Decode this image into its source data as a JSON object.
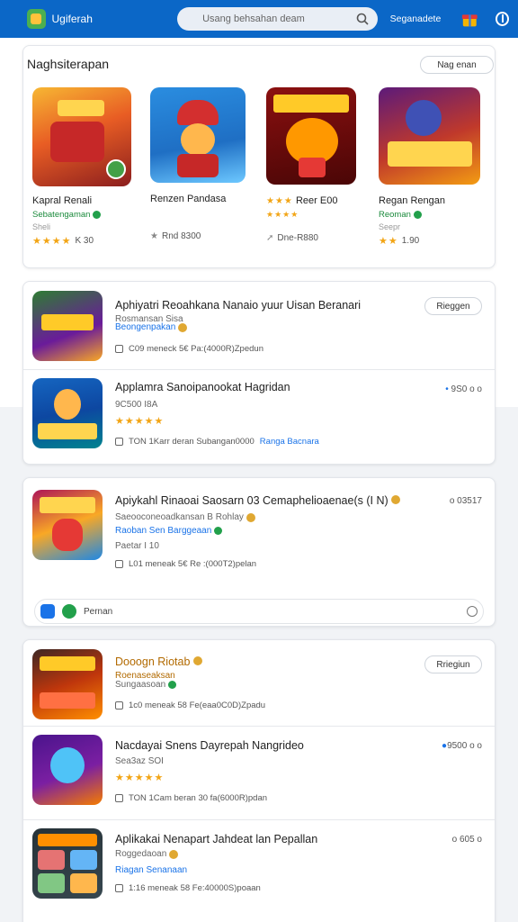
{
  "header": {
    "app_name": "Ugiferah",
    "search_placeholder": "Usang behsahan deam",
    "sign_in": "Seganadete"
  },
  "featured": {
    "title": "Naghsiterapan",
    "see_more": "Nag enan",
    "items": [
      {
        "name": "Kapral Renali",
        "dev": "Sebatengaman",
        "sub": "Sheli",
        "rating": "K 30",
        "stars": "★★★★"
      },
      {
        "name": "Renzen Pandasa",
        "dev": "",
        "sub": "",
        "rating": "Rnd 8300",
        "stars": ""
      },
      {
        "name": "Reer E00",
        "dev": "",
        "sub": "",
        "rating": "Dne-R880",
        "stars": ""
      },
      {
        "name": "Regan Rengan",
        "dev": "Reoman",
        "sub": "Seepr",
        "rating": "1.90",
        "stars": "★★"
      }
    ]
  },
  "list1": {
    "rows": [
      {
        "title": "Aphiyatri Reoahkana Nanaio yuur Uisan Beranari",
        "line1": "Rosmansan Sisa",
        "line2": "Beongenpakan",
        "meta": "C09   meneck 5€ Pa:(4000R)Zpedun",
        "action": "Rieggen"
      },
      {
        "title": "Applamra Sanoipanookat Hagridan",
        "line1": "9C500 I8A",
        "stars": "★★★★★",
        "meta": "TON  1Karr deran Subangan0000",
        "meta_link": "Ranga Bacnara",
        "action": "9S0 o o"
      }
    ]
  },
  "list2": {
    "row": {
      "title": "Apiykahl Rinaoai Saosarn 03  Cemaphelioaenae(s (I N)",
      "line1": "Saeooconeoadkansan B Rohlay",
      "line2": "Raoban Sen Barggeaan",
      "line3": "Paetar I 10",
      "meta": "L01   meneak 5€ Re :(000T2)pelan",
      "action": "o 03517"
    },
    "chip": "Pernan"
  },
  "list3": {
    "rows": [
      {
        "title": "Dooogn Riotab",
        "line1": "Roenaseaksan",
        "line2": "Sungaasoan",
        "meta": "1c0   meneak 58 Fe(eaa0C0D)Zpadu",
        "action": "Rriegiun"
      },
      {
        "title": "Nacdayai Snens Dayrepah Nangrideo",
        "line1": "Sea3az SOI",
        "stars": "★★★★★",
        "meta": "TON 1Cam beran 30 fa(6000R)pdan",
        "action": "9500 o o"
      },
      {
        "title": "Aplikakai Nenapart Jahdeat lan Pepallan",
        "line1": "Roggedaoan",
        "line2": "Riagan Senanaan",
        "meta": "1:16   meneak 58 Fe:40000S)poaan",
        "action": "o 605 o"
      }
    ]
  },
  "colors": {
    "header": "#0b67c7",
    "link": "#1a73e8",
    "star": "#f2a516",
    "verified": "#22a04b"
  }
}
